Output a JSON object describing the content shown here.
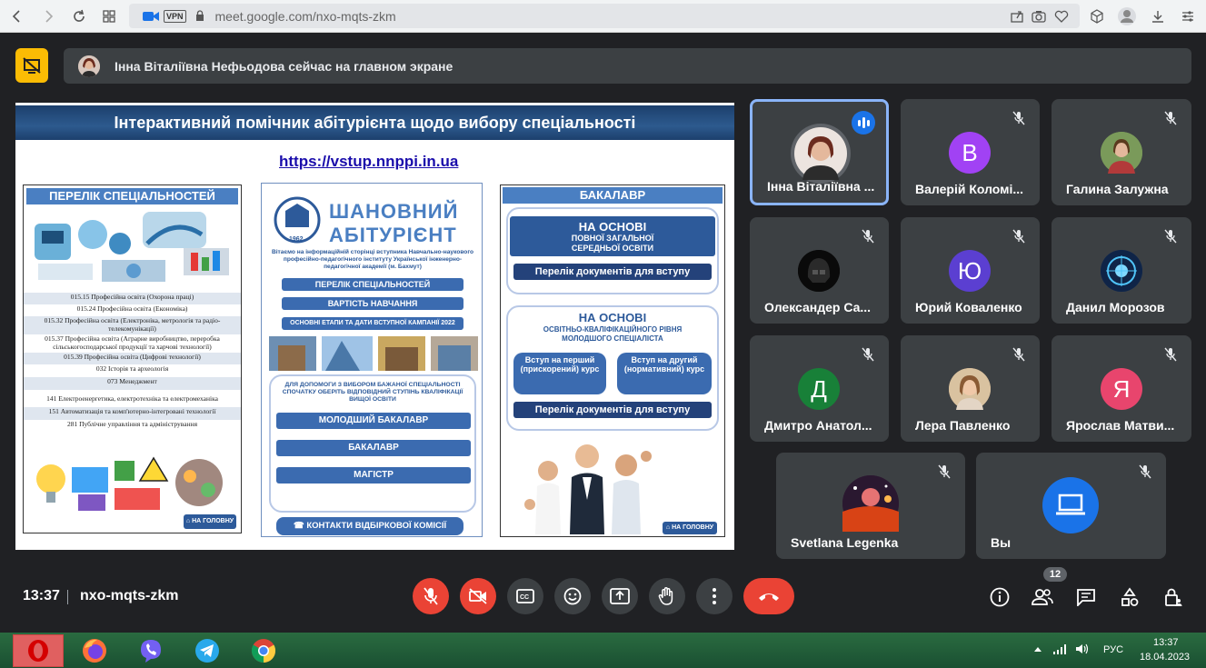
{
  "browser": {
    "url": "meet.google.com/nxo-mqts-zkm",
    "vpn_label": "VPN"
  },
  "banner": {
    "text": "Інна Віталіївна Нефьодова сейчас на главном экране"
  },
  "presentation": {
    "title": "Інтерактивний помічник абітурієнта щодо вибору спеціальності",
    "link": "https://vstup.nnppi.in.ua",
    "left_column": {
      "heading": "ПЕРЕЛІК СПЕЦІАЛЬНОСТЕЙ",
      "rows": [
        "015.15 Професійна освіта (Охорона праці)",
        "015.24 Професійна освіта (Економіка)",
        "015.32 Професійна освіта (Електроніка, метрологія та радіо-телекомунікації)",
        "015.37 Професійна освіта (Аграрне виробництво, переробка сільськогосподарської продукції та харчові технології)",
        "015.39 Професійна освіта (Цифрові технології)",
        "032 Історія та археологія",
        "073 Менеджмент",
        "141 Електроенергетика, електротехніка та електромеханіка",
        "151 Автоматизація та комп'ютерно-інтегровані технології",
        "281 Публічне управління та адміністрування"
      ],
      "home_button": "НА ГОЛОВНУ"
    },
    "middle_column": {
      "big_title_1": "ШАНОВНИЙ",
      "big_title_2": "АБІТУРІЄНТ",
      "logo_year": "1962",
      "welcome": "Вітаємо на інформаційній сторінці вступника Навчально-наукового професійно-педагогічного інституту Української інженерно-педагогічної академії (м. Бахмут)",
      "btn_specialties": "ПЕРЕЛІК СПЕЦІАЛЬНОСТЕЙ",
      "btn_cost": "ВАРТІСТЬ НАВЧАННЯ",
      "btn_stages": "ОСНОВНІ ЕТАПИ ТА ДАТИ ВСТУПНОЇ КАМПАНІЇ 2022",
      "help_text": "ДЛЯ ДОПОМОГИ З ВИБОРОМ БАЖАНОЇ СПЕЦІАЛЬНОСТІ СПОЧАТКУ ОБЕРІТЬ ВІДПОВІДНИЙ СТУПІНЬ КВАЛІФІКАЦІЇ ВИЩОЇ ОСВІТИ",
      "btn_junior": "МОЛОДШИЙ БАКАЛАВР",
      "btn_bachelor": "БАКАЛАВР",
      "btn_master": "МАГІСТР",
      "btn_contacts": "КОНТАКТИ ВІДБІРКОВОЇ КОМІСІЇ"
    },
    "right_column": {
      "heading": "БАКАЛАВР",
      "panel1_title": "НА ОСНОВІ",
      "panel1_sub": "ПОВНОЇ ЗАГАЛЬНОЇ СЕРЕДНЬОЇ ОСВІТИ",
      "panel1_docs": "Перелік документів для вступу",
      "panel2_title": "НА ОСНОВІ",
      "panel2_sub": "ОСВІТНЬО-КВАЛІФІКАЦІЙНОГО РІВНЯ МОЛОДШОГО СПЕЦІАЛІСТА",
      "panel2_first": "Вступ на перший (прискорений) курс",
      "panel2_second": "Вступ на другий (нормативний) курс",
      "panel2_docs": "Перелік документів для вступу",
      "home_button": "НА ГОЛОВНУ"
    }
  },
  "participants": [
    {
      "name": "Інна Віталіївна ...",
      "initial": "",
      "color": "#9aa0a6",
      "active": true
    },
    {
      "name": "Валерій Коломі...",
      "initial": "В",
      "color": "#a142f4"
    },
    {
      "name": "Галина Залужна",
      "initial": "",
      "color": "#6b8e4e"
    },
    {
      "name": "Олександер Са...",
      "initial": "",
      "color": "#111111"
    },
    {
      "name": "Юрий Коваленко",
      "initial": "Ю",
      "color": "#5b3fd1"
    },
    {
      "name": "Данил Морозов",
      "initial": "",
      "color": "#1c3a6e"
    },
    {
      "name": "Дмитро Анатол...",
      "initial": "Д",
      "color": "#188038"
    },
    {
      "name": "Лера Павленко",
      "initial": "",
      "color": "#c89a6e"
    },
    {
      "name": "Ярослав Матви...",
      "initial": "Я",
      "color": "#e8456d"
    },
    {
      "name": "Svetlana Legenka",
      "initial": "",
      "color": "#3b2038"
    },
    {
      "name": "Вы",
      "initial": "",
      "color": "#1a73e8"
    }
  ],
  "controls": {
    "time": "13:37",
    "meeting_code": "nxo-mqts-zkm",
    "participants_count": "12"
  },
  "taskbar": {
    "lang": "РУС",
    "clock_time": "13:37",
    "clock_date": "18.04.2023"
  }
}
